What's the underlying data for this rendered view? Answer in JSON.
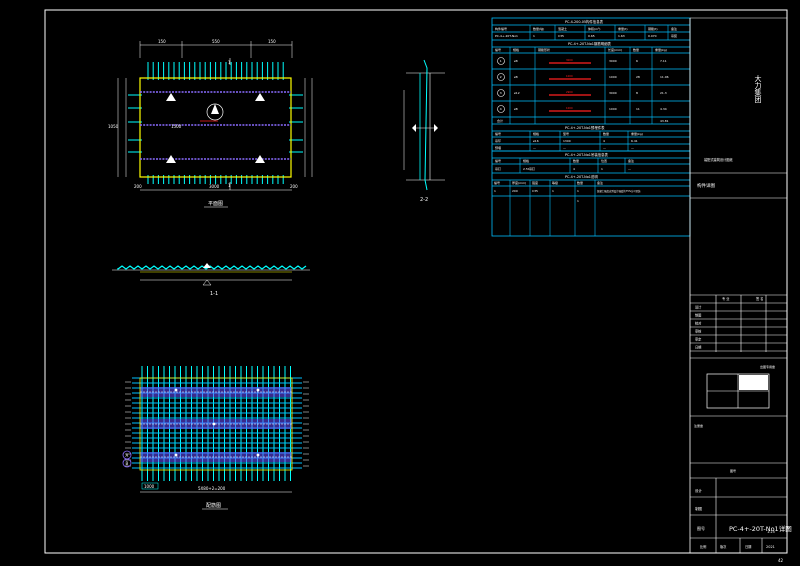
{
  "colors": {
    "background": "#000000",
    "frame": "#ffffff",
    "table_line": "#00bfff",
    "table_text": "#ffffff",
    "rebar_cyan": "#00ffff",
    "slab_outline": "#ffff00",
    "rebar_purple": "#8a6cff",
    "red_mark": "#ff2020",
    "white": "#ffffff"
  },
  "drawing": {
    "plan_view_label": "平面图",
    "section_11_label": "1-1",
    "section_22_label": "2-2",
    "rebar_view_label": "配筋图",
    "rebar_total_dim": "5X80+2=200",
    "plan_dims_top": [
      "150",
      "550",
      "150"
    ],
    "plan_dims_bottom": [
      "200",
      "3000",
      "200"
    ],
    "plan_cut_mark": "1",
    "plan_center_text": "1500",
    "plan_side_dim": "1050",
    "rebar_callouts": [
      "A",
      "B"
    ],
    "rebar_left_tag": "1000",
    "page_number": "42"
  },
  "tables": {
    "info": {
      "title": "PC-4-200-05构件信息表",
      "headers": [
        "构件编号",
        "数量(块)",
        "混凝土",
        "体积(m³)",
        "重量(t)",
        "钢筋(t)",
        "备注"
      ],
      "row": [
        "PC-4+-20T-No1",
        "1",
        "C35",
        "0.65",
        "1.63",
        "0.070",
        "吊装"
      ]
    },
    "rebar": {
      "title": "PC-4+-20T-No1钢筋明细表",
      "headers": [
        "编号",
        "规格",
        "钢筋形状",
        "长度(mm)",
        "数量",
        "重量(kg)"
      ],
      "rows": [
        [
          "1",
          "⌀8",
          "3000",
          "3000",
          "6",
          "7.11"
        ],
        [
          "2",
          "⌀8",
          "1000",
          "1000",
          "28",
          "11.06"
        ],
        [
          "3",
          "⌀12",
          "2900",
          "3000",
          "8",
          "21.3"
        ],
        [
          "4",
          "⌀8",
          "1000",
          "1000",
          "11",
          "4.34"
        ]
      ],
      "total": [
        "合计",
        "43.81"
      ]
    },
    "embed": {
      "title": "PC-4+-20T-No1预埋件表",
      "headers": [
        "编号",
        "规格",
        "型号",
        "数量",
        "重量(kg)"
      ],
      "rows": [
        [
          "吊环",
          "⌀16",
          "1300",
          "4",
          "6.41"
        ],
        [
          "预埋",
          "—",
          "—",
          "—",
          "—"
        ]
      ]
    },
    "lift": {
      "title": "PC-4+-20T-No1吊装信息表",
      "headers": [
        "编号",
        "规格",
        "数量",
        "位置",
        "备注"
      ],
      "row": [
        "吊钉",
        "2.5t吊钉",
        "4",
        "1",
        "—"
      ]
    },
    "notes": {
      "title": "PC-4+-20T-No1说明",
      "headers": [
        "编号",
        "厚度(mm)",
        "强度",
        "等级",
        "数量",
        "备注"
      ],
      "row": [
        "1",
        "200",
        "C35",
        "1",
        "1",
        "混凝土强度达到设计强度的75%方可吊装"
      ],
      "row2": [
        "",
        "",
        "",
        "",
        "1",
        ""
      ]
    }
  },
  "title_block": {
    "company": "大力集团",
    "project": "装配式建筑设计图纸",
    "sheet_label": "构件详图",
    "rows": [
      "设计",
      "制图",
      "校对",
      "审核",
      "审定",
      "日期"
    ],
    "col_heads": [
      "专 业",
      "签 名"
    ],
    "stamp_label": "出图专用章",
    "drawing_no_label": "图号",
    "drawing_title": "PC-4+-20T-No1详图",
    "scale_label": "比例",
    "scale": "1:25",
    "date_label": "日期",
    "date": "2021",
    "version_label": "版次",
    "seal_label": "注册章"
  }
}
